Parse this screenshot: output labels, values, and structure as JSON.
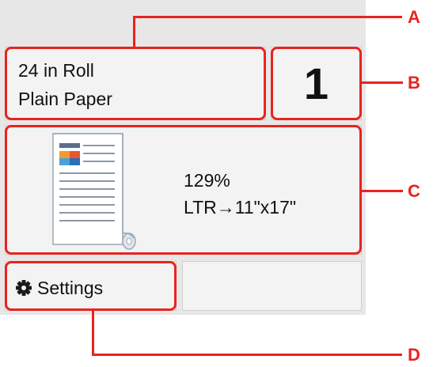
{
  "media": {
    "size": "24 in Roll",
    "type": "Plain Paper"
  },
  "copies": {
    "value": "1"
  },
  "preview": {
    "zoom": "129%",
    "conversion": "LTR→11\"x17\""
  },
  "settings": {
    "label": "Settings",
    "icon": "gear-icon"
  },
  "callouts": {
    "a": "A",
    "b": "B",
    "c": "C",
    "d": "D"
  },
  "colors": {
    "callout": "#e8231f",
    "screen_bg": "#e7e7e7",
    "panel_bg": "#f3f3f3"
  }
}
